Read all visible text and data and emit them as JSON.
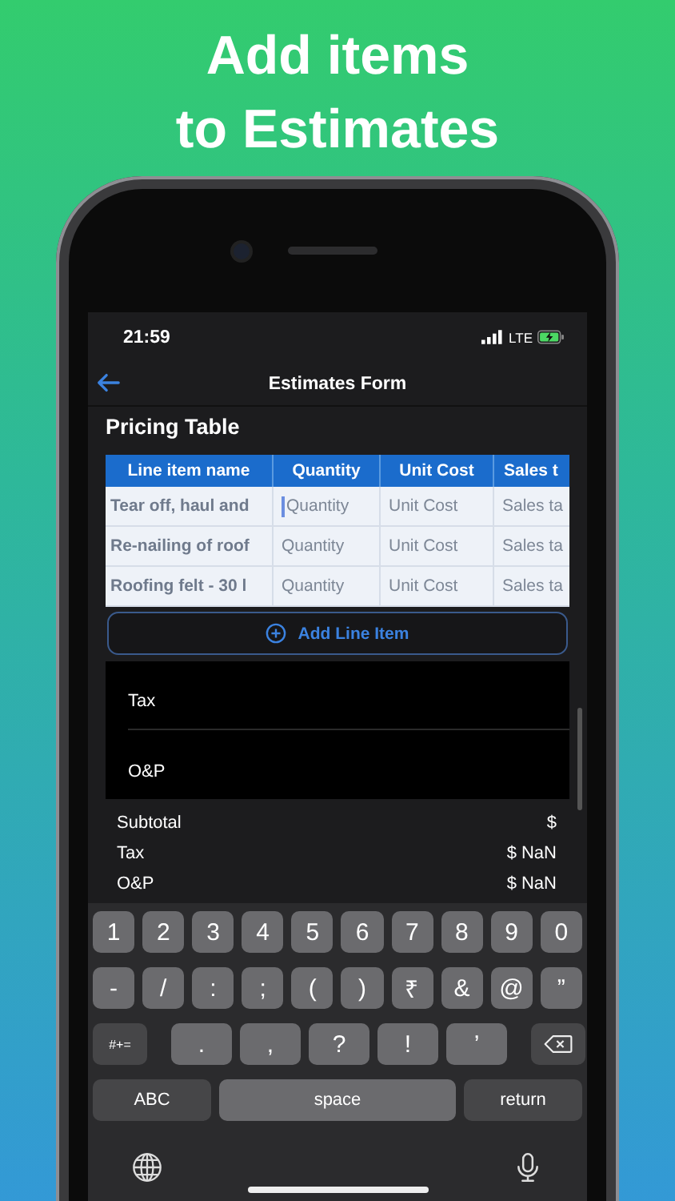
{
  "headline": [
    "Add items",
    "to Estimates"
  ],
  "status_bar": {
    "time": "21:59",
    "network": "LTE"
  },
  "nav": {
    "title": "Estimates Form"
  },
  "section_title": "Pricing Table",
  "table": {
    "columns": [
      "Line item name",
      "Quantity",
      "Unit Cost",
      "Sales t"
    ],
    "rows": [
      {
        "cells": [
          {
            "text": "Tear off, haul and",
            "kind": "value",
            "focused": false
          },
          {
            "text": "Quantity",
            "kind": "placeholder",
            "focused": true
          },
          {
            "text": "Unit Cost",
            "kind": "placeholder",
            "focused": false
          },
          {
            "text": "Sales ta",
            "kind": "placeholder",
            "focused": false
          }
        ]
      },
      {
        "cells": [
          {
            "text": "Re-nailing of roof",
            "kind": "value",
            "focused": false
          },
          {
            "text": "Quantity",
            "kind": "placeholder",
            "focused": false
          },
          {
            "text": "Unit Cost",
            "kind": "placeholder",
            "focused": false
          },
          {
            "text": "Sales ta",
            "kind": "placeholder",
            "focused": false
          }
        ]
      },
      {
        "cells": [
          {
            "text": "Roofing felt - 30 l",
            "kind": "value",
            "focused": false
          },
          {
            "text": "Quantity",
            "kind": "placeholder",
            "focused": false
          },
          {
            "text": "Unit Cost",
            "kind": "placeholder",
            "focused": false
          },
          {
            "text": "Sales ta",
            "kind": "placeholder",
            "focused": false
          }
        ]
      }
    ]
  },
  "add_button": "Add Line Item",
  "fields": [
    "Tax",
    "O&P"
  ],
  "summary": [
    {
      "label": "Subtotal",
      "value": "$"
    },
    {
      "label": "Tax",
      "value": "$ NaN"
    },
    {
      "label": "O&P",
      "value": "$ NaN"
    }
  ],
  "keyboard": {
    "number_row": [
      {
        "label": "1",
        "kind": "char"
      },
      {
        "label": "2",
        "kind": "char"
      },
      {
        "label": "3",
        "kind": "char"
      },
      {
        "label": "4",
        "kind": "char"
      },
      {
        "label": "5",
        "kind": "char"
      },
      {
        "label": "6",
        "kind": "char"
      },
      {
        "label": "7",
        "kind": "char"
      },
      {
        "label": "8",
        "kind": "char"
      },
      {
        "label": "9",
        "kind": "char"
      },
      {
        "label": "0",
        "kind": "char"
      }
    ],
    "symbol_row": [
      {
        "label": "-",
        "kind": "char"
      },
      {
        "label": "/",
        "kind": "char"
      },
      {
        "label": ":",
        "kind": "char"
      },
      {
        "label": ";",
        "kind": "char"
      },
      {
        "label": "(",
        "kind": "char"
      },
      {
        "label": ")",
        "kind": "char"
      },
      {
        "label": "₹",
        "kind": "char"
      },
      {
        "label": "&",
        "kind": "char"
      },
      {
        "label": "@",
        "kind": "char"
      },
      {
        "label": "”",
        "kind": "char"
      }
    ],
    "punctuation_row": [
      {
        "label": "#+=",
        "kind": "mod"
      },
      {
        "label": ".",
        "kind": "wide"
      },
      {
        "label": ",",
        "kind": "wide"
      },
      {
        "label": "?",
        "kind": "wide"
      },
      {
        "label": "!",
        "kind": "wide"
      },
      {
        "label": "’",
        "kind": "wide"
      },
      {
        "kind": "delete"
      }
    ],
    "bottom_row": [
      {
        "label": "ABC",
        "kind": "mod"
      },
      {
        "label": "space",
        "kind": "space"
      },
      {
        "label": "return",
        "kind": "mod"
      }
    ],
    "system_row": [
      {
        "kind": "globe"
      },
      {
        "kind": "mic"
      }
    ]
  }
}
